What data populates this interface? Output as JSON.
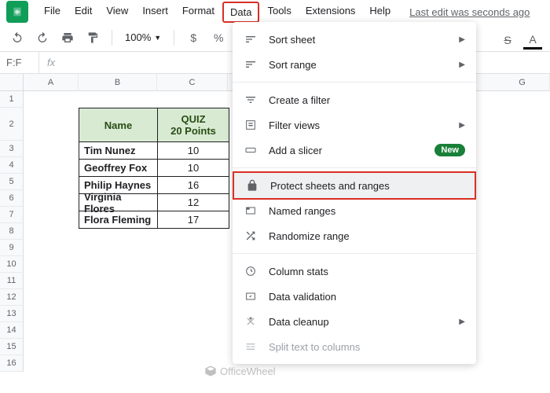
{
  "doc_icon_letter": "",
  "menu": {
    "file": "File",
    "edit": "Edit",
    "view": "View",
    "insert": "Insert",
    "format": "Format",
    "data": "Data",
    "tools": "Tools",
    "extensions": "Extensions",
    "help": "Help"
  },
  "last_edit": "Last edit was seconds ago",
  "toolbar": {
    "zoom": "100%",
    "currency": "$",
    "percent": "%"
  },
  "name_box": "F:F",
  "fx": "fx",
  "columns": [
    "A",
    "B",
    "C",
    "G"
  ],
  "rows": [
    "1",
    "2",
    "3",
    "4",
    "5",
    "6",
    "7",
    "8",
    "9",
    "10",
    "11",
    "12",
    "13",
    "14",
    "15",
    "16"
  ],
  "table": {
    "header_name": "Name",
    "header_quiz_line1": "QUIZ",
    "header_quiz_line2": "20 Points",
    "rows": [
      {
        "name": "Tim Nunez",
        "quiz": "10"
      },
      {
        "name": "Geoffrey Fox",
        "quiz": "10"
      },
      {
        "name": "Philip Haynes",
        "quiz": "16"
      },
      {
        "name": "Virginia Flores",
        "quiz": "12"
      },
      {
        "name": "Flora Fleming",
        "quiz": "17"
      }
    ]
  },
  "dropdown": {
    "sort_sheet": "Sort sheet",
    "sort_range": "Sort range",
    "create_filter": "Create a filter",
    "filter_views": "Filter views",
    "add_slicer": "Add a slicer",
    "new_badge": "New",
    "protect": "Protect sheets and ranges",
    "named_ranges": "Named ranges",
    "randomize": "Randomize range",
    "column_stats": "Column stats",
    "data_validation": "Data validation",
    "data_cleanup": "Data cleanup",
    "split_text": "Split text to columns"
  },
  "watermark": "OfficeWheel"
}
